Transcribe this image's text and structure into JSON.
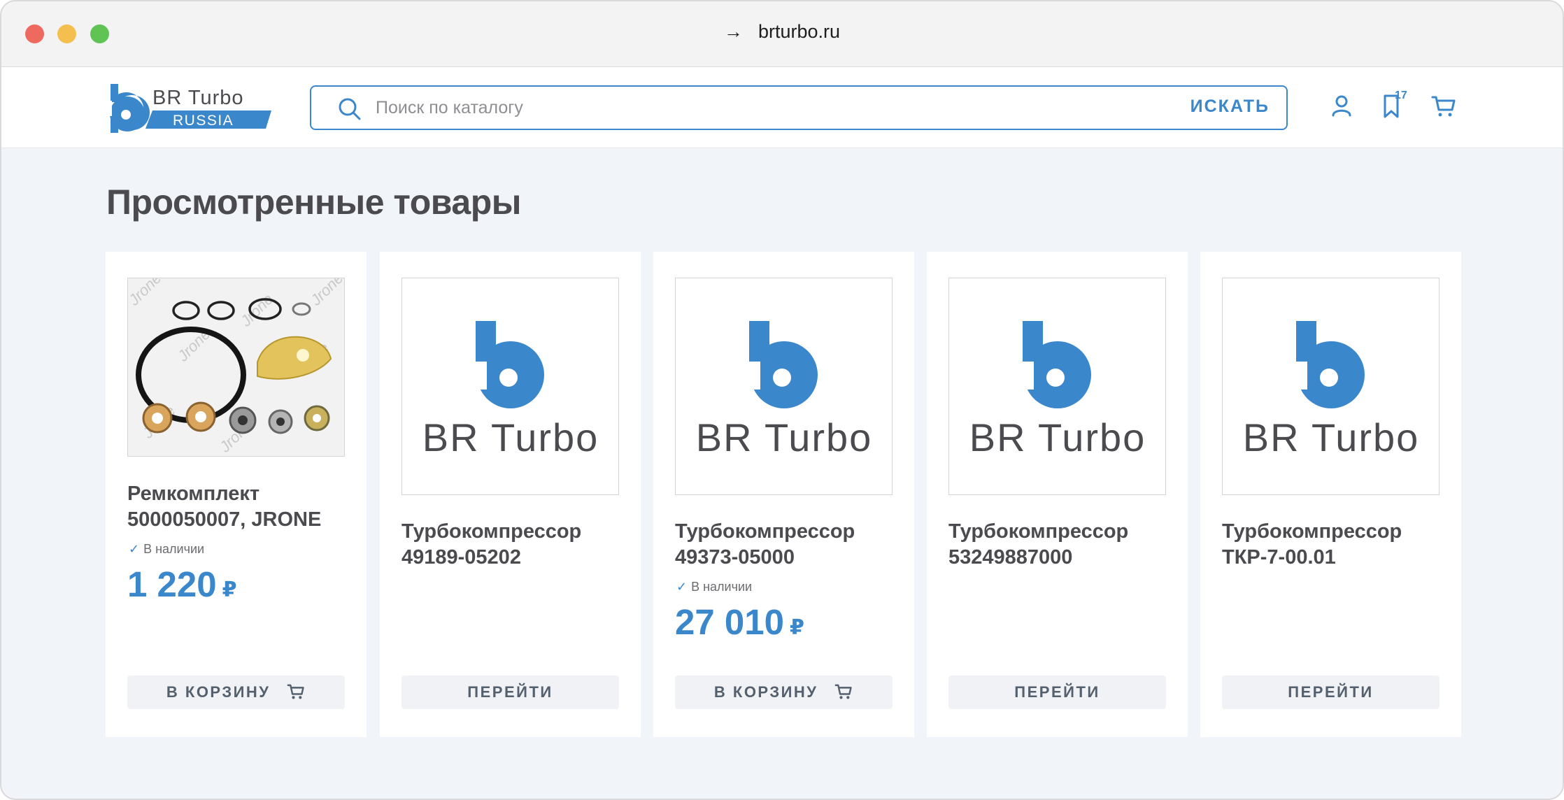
{
  "browser": {
    "url": "brturbo.ru",
    "arrow": "→"
  },
  "header": {
    "logo_top": "BR Turbo",
    "logo_bottom": "RUSSIA",
    "search_placeholder": "Поиск по каталогу",
    "search_button": "ИСКАТЬ",
    "favorites_count": "17",
    "icons": [
      "user-icon",
      "bookmark-icon",
      "cart-icon"
    ]
  },
  "page": {
    "title": "Просмотренные товары"
  },
  "products": [
    {
      "name": "Ремкомплект 5000050007, JRONE",
      "stock": "В наличии",
      "price": "1 220",
      "currency": "₽",
      "button": "В КОРЗИНУ",
      "image": "repair-kit-photo"
    },
    {
      "name": "Турбокомпрессор 49189-05202",
      "stock": "",
      "price": "",
      "currency": "",
      "button": "ПЕРЕЙТИ",
      "image": "br-turbo-logo"
    },
    {
      "name": "Турбокомпрессор 49373-05000",
      "stock": "В наличии",
      "price": "27 010",
      "currency": "₽",
      "button": "В КОРЗИНУ",
      "image": "br-turbo-logo"
    },
    {
      "name": "Турбокомпрессор 53249887000",
      "stock": "",
      "price": "",
      "currency": "",
      "button": "ПЕРЕЙТИ",
      "image": "br-turbo-logo"
    },
    {
      "name": "Турбокомпрессор ТКР-7-00.01",
      "stock": "",
      "price": "",
      "currency": "",
      "button": "ПЕРЕЙТИ",
      "image": "br-turbo-logo"
    }
  ],
  "colors": {
    "accent": "#3b87cb",
    "background": "#f1f4f8",
    "text": "#4a4a4f",
    "button_bg": "#f0f2f5"
  }
}
